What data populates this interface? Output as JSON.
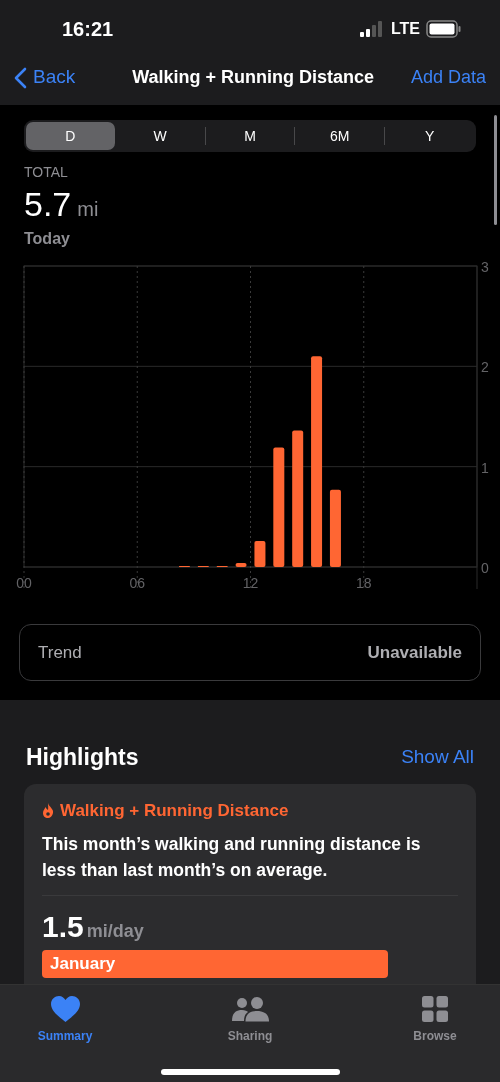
{
  "status_bar": {
    "time": "16:21",
    "network": "LTE"
  },
  "nav": {
    "back": "Back",
    "title": "Walking + Running Distance",
    "action": "Add Data"
  },
  "periods": [
    {
      "label": "D",
      "selected": true
    },
    {
      "label": "W",
      "selected": false
    },
    {
      "label": "M",
      "selected": false
    },
    {
      "label": "6M",
      "selected": false
    },
    {
      "label": "Y",
      "selected": false
    }
  ],
  "summary": {
    "label": "TOTAL",
    "value": "5.7",
    "unit": "mi",
    "date": "Today"
  },
  "chart_data": {
    "type": "bar",
    "x": [
      8.5,
      9.5,
      10.5,
      11.5,
      12.5,
      13.5,
      14.5,
      15.5,
      16.5
    ],
    "values": [
      0.01,
      0.01,
      0.01,
      0.04,
      0.26,
      1.19,
      1.36,
      2.1,
      0.77
    ],
    "color": "#ff6633",
    "xlim": [
      0,
      24
    ],
    "ylim": [
      0,
      3
    ],
    "xticks": [
      {
        "value": 0,
        "label": "00"
      },
      {
        "value": 6,
        "label": "06"
      },
      {
        "value": 12,
        "label": "12"
      },
      {
        "value": 18,
        "label": "18"
      }
    ],
    "yticks": [
      0,
      1,
      2,
      3
    ],
    "grid": true
  },
  "trend": {
    "label": "Trend",
    "value": "Unavailable"
  },
  "highlights": {
    "title": "Highlights",
    "action": "Show All",
    "card": {
      "title": "Walking + Running Distance",
      "text": "This month’s walking and running distance is less than last month’s on average.",
      "value": "1.5",
      "unit": "mi/day",
      "bar_label": "January"
    }
  },
  "tab_bar": [
    {
      "label": "Summary",
      "selected": true
    },
    {
      "label": "Sharing",
      "selected": false
    },
    {
      "label": "Browse",
      "selected": false
    }
  ]
}
